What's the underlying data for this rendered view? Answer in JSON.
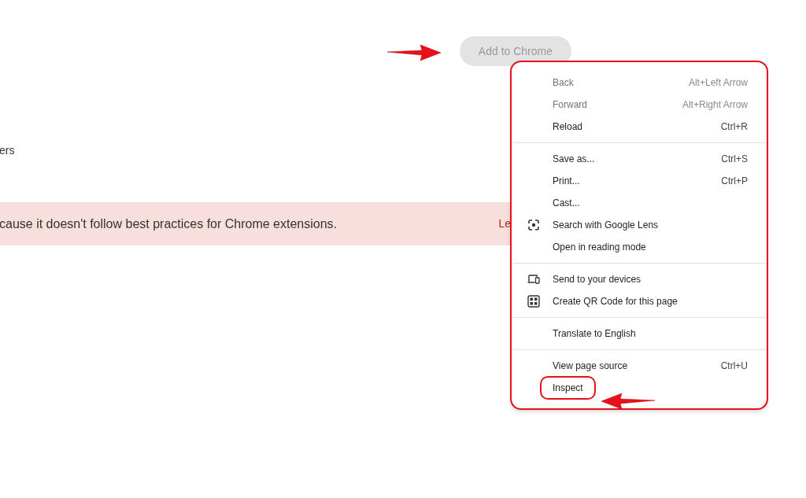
{
  "page": {
    "install_button": {
      "label": "Add to Chrome",
      "disabled": true
    },
    "partial_text": "ers",
    "banner": {
      "message": "cause it doesn't follow best practices for Chrome extensions.",
      "link": "Le"
    }
  },
  "context_menu": {
    "sections": [
      {
        "items": [
          {
            "label": "Back",
            "shortcut": "Alt+Left Arrow",
            "disabled": true,
            "highlighted": false
          },
          {
            "label": "Forward",
            "shortcut": "Alt+Right Arrow",
            "disabled": true,
            "highlighted": false
          },
          {
            "label": "Reload",
            "shortcut": "Ctrl+R",
            "disabled": false,
            "highlighted": false
          }
        ]
      },
      {
        "items": [
          {
            "label": "Save as...",
            "shortcut": "Ctrl+S",
            "disabled": false,
            "highlighted": false
          },
          {
            "label": "Print...",
            "shortcut": "Ctrl+P",
            "disabled": false,
            "highlighted": false
          },
          {
            "label": "Cast...",
            "disabled": false,
            "highlighted": false
          },
          {
            "label": "Search with Google Lens",
            "kind": "lens",
            "disabled": false,
            "highlighted": false
          },
          {
            "label": "Open in reading mode",
            "disabled": false,
            "highlighted": false
          }
        ]
      },
      {
        "items": [
          {
            "label": "Send to your devices",
            "kind": "devices",
            "disabled": false,
            "highlighted": false
          },
          {
            "label": "Create QR Code for this page",
            "kind": "qr",
            "disabled": false,
            "highlighted": false
          }
        ]
      },
      {
        "items": [
          {
            "label": "Translate to English",
            "disabled": false,
            "highlighted": false
          }
        ]
      },
      {
        "items": [
          {
            "label": "View page source",
            "shortcut": "Ctrl+U",
            "disabled": false,
            "highlighted": false
          },
          {
            "label": "Inspect",
            "disabled": false,
            "highlighted": true
          }
        ]
      }
    ]
  }
}
